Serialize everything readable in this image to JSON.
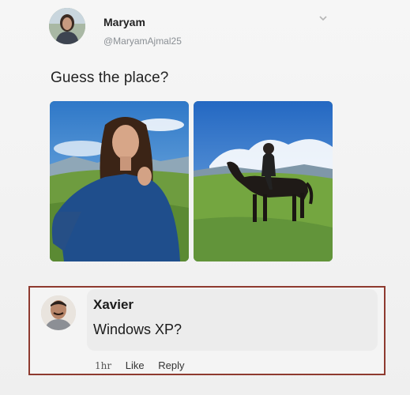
{
  "tweet": {
    "author_name": "Maryam",
    "author_handle": "@MaryamAjmal25",
    "text": "Guess the place?",
    "avatar_icon": "user-avatar",
    "menu_icon": "chevron-down-icon"
  },
  "photos": [
    {
      "icon": "photo-woman-selfie-mountains"
    },
    {
      "icon": "photo-rider-on-horse-meadow"
    }
  ],
  "reply": {
    "author_name": "Xavier",
    "text": "Windows XP?",
    "time": "1hr",
    "like_label": "Like",
    "reply_label": "Reply",
    "highlight_color": "#8e3a2f",
    "avatar_icon": "user-avatar"
  }
}
